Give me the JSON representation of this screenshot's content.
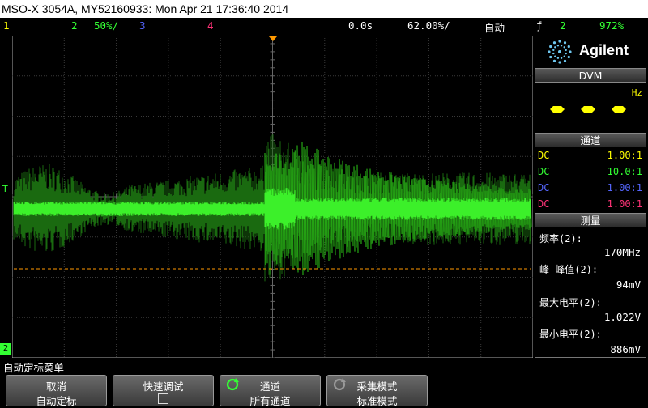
{
  "title": "MSO-X 3054A, MY52160933: Mon Apr 21 17:36:40 2014",
  "status": {
    "ch1": "1",
    "ch2": "2",
    "ch2_scale": "50%/",
    "ch3": "3",
    "ch4": "4",
    "time_delay": "0.0s",
    "time_scale": "62.00%/",
    "trigger_mode": "自动",
    "trigger_source": "2",
    "trigger_level": "972%"
  },
  "markers": {
    "trigger_level": "T",
    "ground_ch2": "2"
  },
  "brand": "Agilent",
  "dvm": {
    "header": "DVM",
    "unit": "Hz"
  },
  "channels": {
    "header": "通道",
    "rows": [
      {
        "coupling": "DC",
        "ratio": "1.00:1",
        "color": "#ffff00"
      },
      {
        "coupling": "DC",
        "ratio": "10.0:1",
        "color": "#33ff33"
      },
      {
        "coupling": "DC",
        "ratio": "1.00:1",
        "color": "#5566ff"
      },
      {
        "coupling": "DC",
        "ratio": "1.00:1",
        "color": "#ff3377"
      }
    ]
  },
  "measurements": {
    "header": "测量",
    "items": [
      {
        "label": "频率(2):",
        "value": "170MHz"
      },
      {
        "label": "峰-峰值(2):",
        "value": "94mV"
      },
      {
        "label": "最大电平(2):",
        "value": "1.022V"
      },
      {
        "label": "最小电平(2):",
        "value": "886mV"
      }
    ]
  },
  "menu": {
    "title": "自动定标菜单",
    "softkeys": [
      {
        "line1": "取消",
        "line2": "自动定标"
      },
      {
        "line1": "快速调试",
        "line2": ""
      },
      {
        "line1": "通道",
        "line2": "所有通道"
      },
      {
        "line1": "采集模式",
        "line2": "标准模式"
      }
    ]
  },
  "colors": {
    "ch1": "#ffff00",
    "ch2": "#33ff33",
    "ch3": "#5566ff",
    "ch4": "#ff3377",
    "trigger": "#ff9900",
    "waveform": "#2bd81a"
  }
}
